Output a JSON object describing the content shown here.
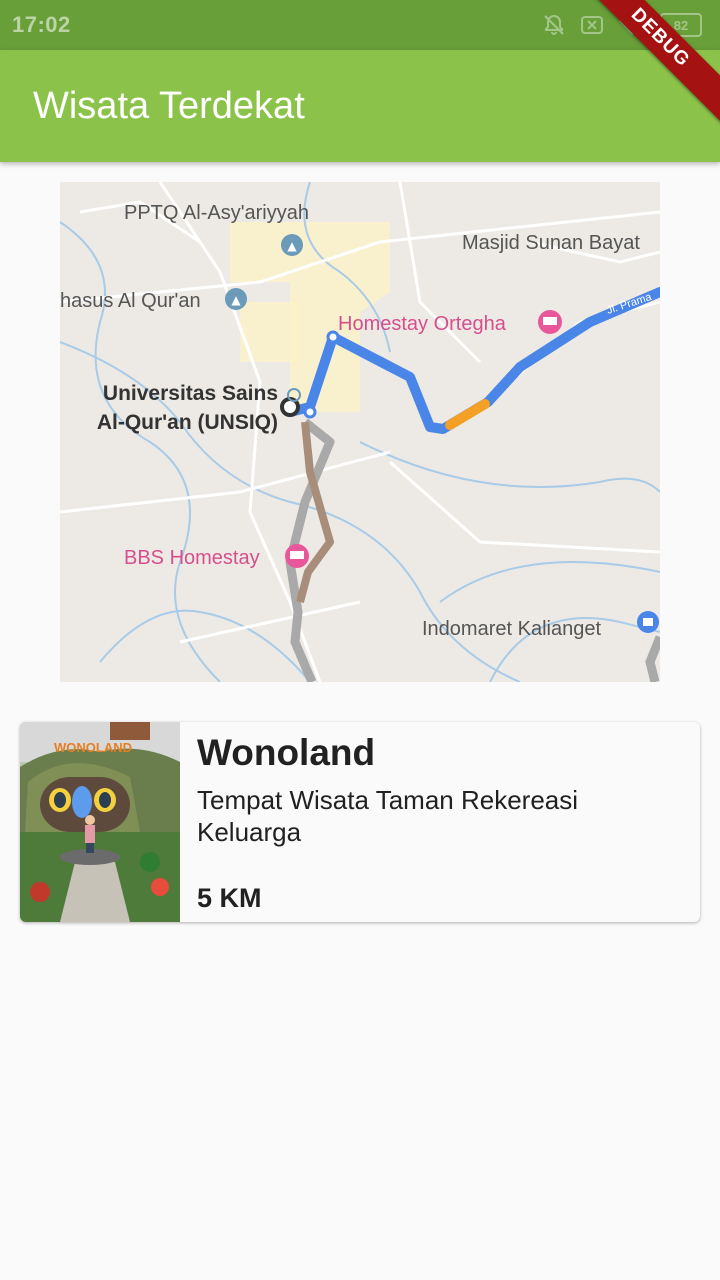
{
  "status_bar": {
    "time": "17:02",
    "battery": "82"
  },
  "app_bar": {
    "title": "Wisata Terdekat"
  },
  "debug_banner": "DEBUG",
  "map": {
    "labels": {
      "pptq": "PPTQ Al-Asy'ariyyah",
      "masjid": "Masjid Sunan Bayat",
      "mahasus": "hasus Al Qur'an",
      "homestay_ortegha": "Homestay Ortegha",
      "unsiq_1": "Universitas Sains",
      "unsiq_2": "Al-Qur'an (UNSIQ)",
      "bbs_homestay": "BBS Homestay",
      "indomaret": "Indomaret Kalianget",
      "road": "Jl. Prama"
    },
    "colors": {
      "route": "#4a86e8",
      "route_traffic": "#f4a025",
      "route_alt": "#9e9e9e",
      "hotel_pin": "#e8579a",
      "school_pin": "#5d8aa8",
      "shop_pin": "#4a86e8"
    }
  },
  "places": [
    {
      "name": "Wonoland",
      "description": "Tempat Wisata Taman Rekereasi Keluarga",
      "distance": "5 KM",
      "photo_sign": "WONOLAND"
    }
  ],
  "theme": {
    "primary": "#8bc34a",
    "primary_dark": "#689f38",
    "background": "#fafafa"
  }
}
